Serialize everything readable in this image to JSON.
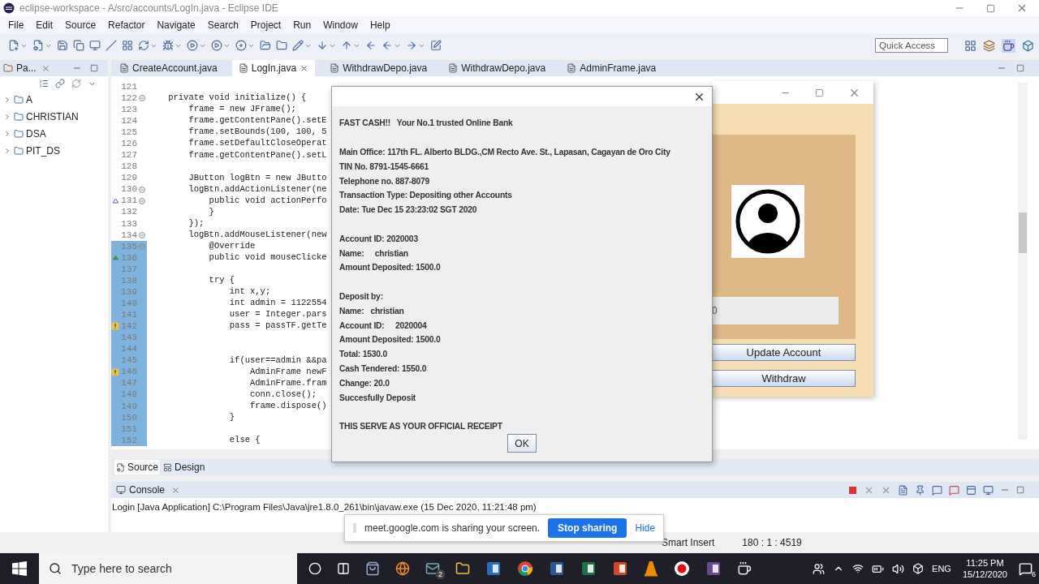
{
  "window": {
    "title": "eclipse-workspace - A/src/accounts/LogIn.java - Eclipse IDE"
  },
  "menu": [
    "File",
    "Edit",
    "Source",
    "Refactor",
    "Navigate",
    "Search",
    "Project",
    "Run",
    "Window",
    "Help"
  ],
  "quick_access": {
    "placeholder": "Quick Access"
  },
  "left_panel": {
    "tab": "Pa...",
    "items": [
      {
        "label": "A",
        "expanded": false
      },
      {
        "label": "CHRISTIAN",
        "expanded": false
      },
      {
        "label": "DSA",
        "expanded": false
      },
      {
        "label": "PIT_DS",
        "expanded": false
      }
    ]
  },
  "editor_tabs": [
    {
      "label": "CreateAccount.java",
      "selected": false
    },
    {
      "label": "LogIn.java",
      "selected": true
    },
    {
      "label": "WithdrawDepo.java",
      "selected": false
    },
    {
      "label": "WithdrawDepo.java",
      "selected": false
    },
    {
      "label": "AdminFrame.java",
      "selected": false
    }
  ],
  "code_lines": [
    {
      "number": "121",
      "fold": false,
      "changed": false
    },
    {
      "number": "122",
      "text": "    private void initialize() {",
      "fold": true,
      "changed": false
    },
    {
      "number": "123",
      "text": "        frame = new JFrame();",
      "fold": false,
      "changed": false
    },
    {
      "number": "124",
      "text": "        frame.getContentPane().setE",
      "fold": false,
      "changed": false
    },
    {
      "number": "125",
      "text": "        frame.setBounds(100, 100, 5",
      "fold": false,
      "changed": false
    },
    {
      "number": "126",
      "text": "        frame.setDefaultCloseOperat",
      "fold": false,
      "changed": false
    },
    {
      "number": "127",
      "text": "        frame.getContentPane().setL",
      "fold": false,
      "changed": false
    },
    {
      "number": "128",
      "fold": false,
      "changed": false
    },
    {
      "number": "129",
      "text": "        JButton logBtn = new JButto",
      "fold": false,
      "changed": false
    },
    {
      "number": "130",
      "text": "        logBtn.addActionListener(ne",
      "fold": true,
      "changed": false
    },
    {
      "number": "131",
      "text": "            public void actionPerfo",
      "fold": true,
      "kind": "implements",
      "changed": false
    },
    {
      "number": "132",
      "text": "            }",
      "fold": false,
      "changed": false
    },
    {
      "number": "133",
      "text": "        });",
      "fold": false,
      "changed": false
    },
    {
      "number": "134",
      "text": "        logBtn.addMouseListener(new",
      "fold": true,
      "changed": false
    },
    {
      "number": "135",
      "text": "            @Override",
      "fold": true,
      "changed": true
    },
    {
      "number": "136",
      "text": "            public void mouseClicke",
      "fold": false,
      "kind": "override",
      "changed": true
    },
    {
      "number": "137",
      "fold": false,
      "changed": true
    },
    {
      "number": "138",
      "text": "            try {",
      "fold": false,
      "changed": true
    },
    {
      "number": "139",
      "text": "                int x,y;",
      "fold": false,
      "changed": true
    },
    {
      "number": "140",
      "text": "                int admin = 1122554",
      "fold": false,
      "changed": true
    },
    {
      "number": "141",
      "text": "                user = Integer.pars",
      "fold": false,
      "changed": true
    },
    {
      "number": "142",
      "text": "                pass = passTF.getTe",
      "fold": false,
      "kind": "warning",
      "changed": true
    },
    {
      "number": "143",
      "fold": false,
      "changed": true
    },
    {
      "number": "144",
      "fold": false,
      "changed": true
    },
    {
      "number": "145",
      "text": "                if(user==admin &&pa",
      "fold": false,
      "changed": true
    },
    {
      "number": "146",
      "text": "                    AdminFrame newF",
      "fold": false,
      "kind": "warning",
      "changed": true
    },
    {
      "number": "147",
      "text": "                    AdminFrame.fram",
      "fold": false,
      "changed": true
    },
    {
      "number": "148",
      "text": "                    conn.close();",
      "fold": false,
      "changed": true
    },
    {
      "number": "149",
      "text": "                    frame.dispose()",
      "fold": false,
      "changed": true
    },
    {
      "number": "150",
      "text": "                }",
      "fold": false,
      "changed": true
    },
    {
      "number": "151",
      "fold": false,
      "changed": true
    },
    {
      "number": "152",
      "text": "                else {",
      "fold": false,
      "changed": true
    }
  ],
  "editor_bottom_tabs": [
    {
      "label": "Source",
      "selected": true
    },
    {
      "label": "Design",
      "selected": false
    }
  ],
  "console": {
    "title": "Console",
    "text": "Login [Java Application] C:\\Program Files\\Java\\jre1.8.0_261\\bin\\javaw.exe (15 Dec 2020, 11:21:48 pm)"
  },
  "status_bar": {
    "mode": "Smart Insert",
    "position": "180 : 1 : 4519"
  },
  "share_bar": {
    "message": "meet.google.com is sharing your screen.",
    "stop": "Stop sharing",
    "hide": "Hide"
  },
  "frame": {
    "field_value": "0",
    "buttons": [
      "Update Account",
      "Withdraw"
    ]
  },
  "dialog": {
    "sections": [
      [
        "FAST CASH!!   Your No.1 trusted Online Bank"
      ],
      [
        "Main Office: 117th FL. Alberto BLDG.,CM Recto Ave. St., Lapasan, Cagayan de Oro City",
        "TIN No. 8791-1545-6661",
        "Telephone no. 887-8079",
        "Transaction Type: Depositing other Accounts",
        "Date: Tue Dec 15 23:23:02 SGT 2020"
      ],
      [
        "Account ID: 2020003",
        "Name:     christian",
        "Amount Deposited: 1500.0"
      ],
      [
        "Deposit by:",
        "Name:   christian",
        "Account ID:     2020004",
        "Amount Deposited: 1500.0",
        "Total: 1530.0",
        "Cash Tendered: 1550.0",
        "Change: 20.0",
        "Succesfully Deposit"
      ],
      [
        "THIS SERVE AS YOUR OFFICIAL RECEIPT"
      ]
    ],
    "button": "OK"
  },
  "taskbar": {
    "search_placeholder": "Type here to search",
    "mail_badge": "2",
    "language": "ENG",
    "time": "11:25 PM",
    "date": "15/12/2020",
    "notifications": "6"
  }
}
